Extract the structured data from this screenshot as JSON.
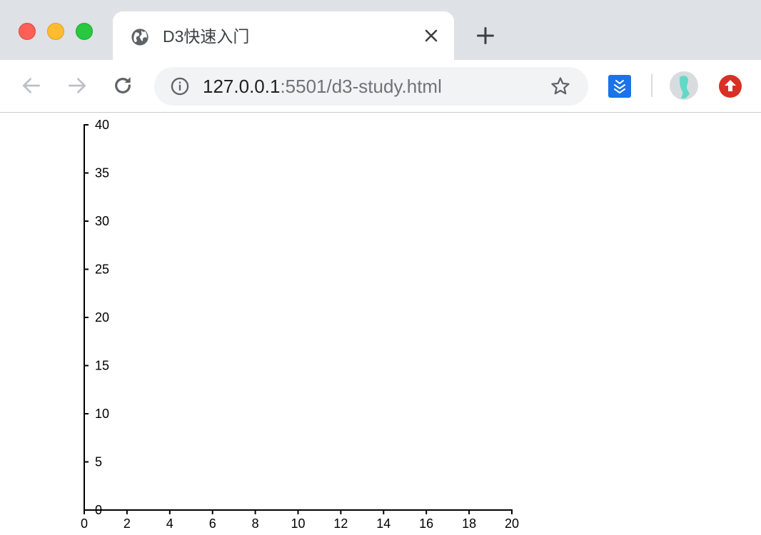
{
  "window": {
    "traffic_lights": [
      "close",
      "minimize",
      "maximize"
    ]
  },
  "tab": {
    "title": "D3快速入门",
    "icon": "globe-icon"
  },
  "toolbar": {
    "url_host": "127.0.0.1",
    "url_path": ":5501/d3-study.html",
    "icons": [
      "back-arrow-icon",
      "forward-arrow-icon",
      "reload-icon",
      "info-icon",
      "bookmark-star-icon",
      "extension-icon",
      "avatar",
      "upload-extension-icon"
    ]
  },
  "colors": {
    "titlebar": "#dee1e6",
    "omnibox": "#f1f3f4",
    "axis": "#000000",
    "extension_blue": "#1a73e8",
    "extension_red": "#d93025"
  },
  "chart_data": {
    "type": "scatter",
    "x_ticks": [
      0,
      2,
      4,
      6,
      8,
      10,
      12,
      14,
      16,
      18,
      20
    ],
    "y_ticks": [
      0,
      5,
      10,
      15,
      20,
      25,
      30,
      35,
      40
    ],
    "xlim": [
      0,
      20
    ],
    "ylim": [
      0,
      40
    ],
    "series": [],
    "title": "",
    "xlabel": "",
    "ylabel": "",
    "grid": false
  }
}
